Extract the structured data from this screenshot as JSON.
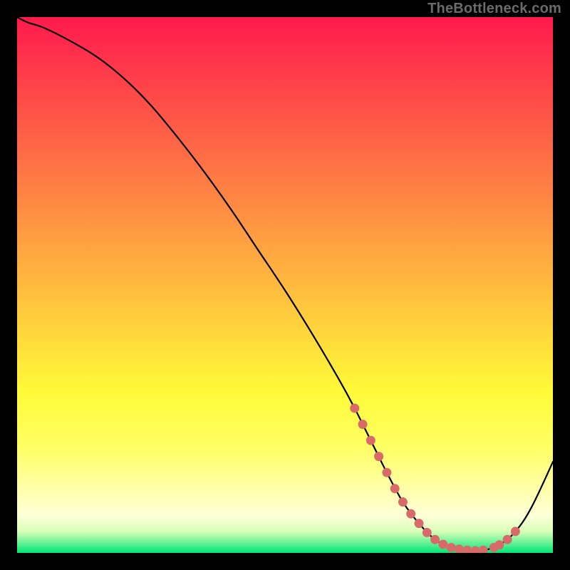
{
  "watermark": "TheBottleneck.com",
  "chart_data": {
    "type": "line",
    "title": "",
    "xlabel": "",
    "ylabel": "",
    "xlim": [
      0,
      100
    ],
    "ylim": [
      0,
      100
    ],
    "grid": false,
    "legend": false,
    "background": "rainbow-vertical-gradient",
    "series": [
      {
        "name": "bottleneck-curve",
        "x": [
          0,
          2,
          5,
          10,
          15,
          20,
          25,
          30,
          35,
          40,
          45,
          50,
          55,
          60,
          63,
          66,
          69,
          72,
          75,
          78,
          81,
          84,
          87,
          90,
          93,
          96,
          100
        ],
        "values": [
          100,
          99,
          98,
          95.5,
          92.5,
          88.5,
          83.5,
          77.5,
          71,
          64,
          56.5,
          49,
          41,
          32.5,
          27,
          21,
          15,
          9.5,
          5.5,
          2.5,
          1.0,
          0.5,
          0.5,
          1.5,
          4.0,
          8.5,
          17
        ]
      }
    ],
    "highlight_markers": {
      "description": "pink dotted segment near the minimum",
      "color": "#d96a6a",
      "x": [
        63,
        64.5,
        66,
        67.5,
        69,
        70.5,
        72,
        73.5,
        75,
        76.5,
        78,
        79.5,
        81,
        82.5,
        84,
        85.5,
        87,
        89,
        90,
        91.5,
        93
      ],
      "values": [
        27,
        24,
        21,
        18,
        15,
        12,
        9.5,
        7.3,
        5.5,
        3.8,
        2.5,
        1.6,
        1.0,
        0.7,
        0.5,
        0.4,
        0.5,
        1.0,
        1.5,
        2.5,
        4.0
      ]
    }
  }
}
